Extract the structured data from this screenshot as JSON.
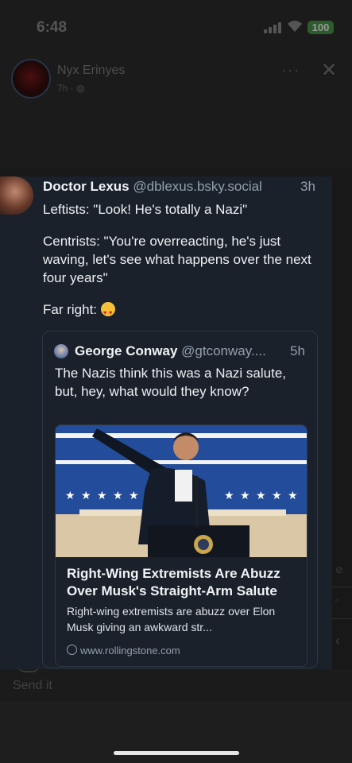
{
  "status_bar": {
    "time": "6:48",
    "battery": "100"
  },
  "story": {
    "name": "Nyx Erinyes",
    "meta": "7h · ",
    "more_icon": "more-horizontal-icon",
    "close_icon": "close-icon"
  },
  "post": {
    "author_name": "Doctor Lexus",
    "author_handle": "@dblexus.bsky.social",
    "time": "3h",
    "paragraphs": [
      "Leftists: \"Look! He's totally a Nazi\"",
      "Centrists: \"You're overreacting, he's just waving, let's see what happens over the next four years\"",
      "Far right: "
    ],
    "emoji": "smiling-face-with-heart-eyes",
    "quote": {
      "author_name": "George Conway",
      "author_handle": "@gtconway....",
      "time": "5h",
      "text": "The Nazis think this was a Nazi salute, but, hey, what would they know?",
      "link": {
        "title": "Right-Wing Extremists Are Abuzz Over Musk's Straight-Arm Salute",
        "description": "Right-wing extremists are abuzz over Elon Musk giving an awkward str...",
        "domain": "www.rollingstone.com"
      }
    }
  },
  "comment_text": "Send it",
  "colors": {
    "background": "#181818",
    "card": "#1a212b",
    "muted_text": "#93a0ad",
    "flag_blue": "#234d9a"
  }
}
